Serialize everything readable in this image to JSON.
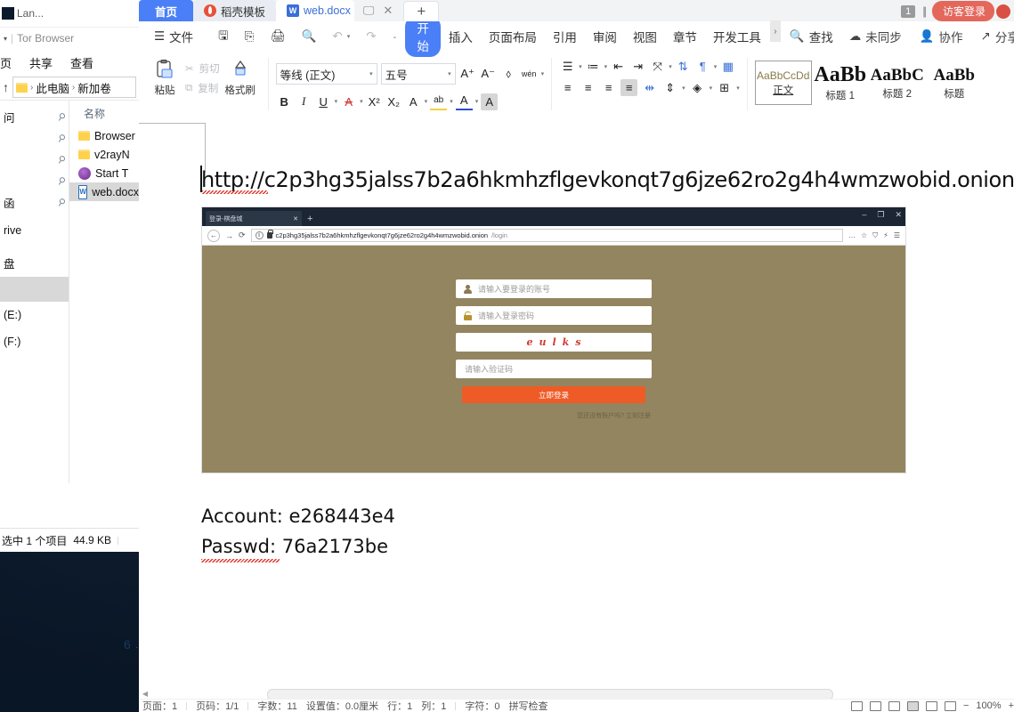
{
  "explorer": {
    "title": "Tor Browser",
    "title_prefix": "Lan...",
    "qat_caret": "▾",
    "ribbon_tabs": [
      "页",
      "共享",
      "查看"
    ],
    "up_arrow": "↑",
    "breadcrumb": [
      "此电脑",
      "新加卷"
    ],
    "crumb_sep": "›",
    "nav_items": [
      "问",
      "",
      "",
      "",
      "函",
      "rive",
      "盘",
      "",
      "(E:)",
      "(F:)"
    ],
    "pin_glyph": "📌",
    "column_header": "名称",
    "files": [
      {
        "name": "Browser",
        "icon": "folder-icon",
        "selected": false
      },
      {
        "name": "v2rayN",
        "icon": "folder-icon",
        "selected": false
      },
      {
        "name": "Start T",
        "icon": "onion-icon",
        "selected": false
      },
      {
        "name": "web.docx",
        "icon": "word-doc-icon",
        "selected": true
      }
    ],
    "status_selected": "选中 1 个项目",
    "status_size": "44.9 KB"
  },
  "wps": {
    "tabs": [
      {
        "label": "首页",
        "type": "home"
      },
      {
        "label": "稻壳模板",
        "type": "template"
      },
      {
        "label": "web.docx",
        "type": "document"
      }
    ],
    "tab_monitor_icon": "monitor-icon",
    "tab_close_icon": "✕",
    "new_tab": "+",
    "page_count": "1",
    "guest_login": "访客登录",
    "menu": {
      "file_icon": "hamburger-icon",
      "file_label": "文件",
      "quick_icons": [
        "save-icon",
        "save-as-icon",
        "print-icon",
        "print-preview-icon"
      ],
      "undo": "↶",
      "redo": "↷",
      "more_caret": "⌄",
      "tabs": [
        "开始",
        "插入",
        "页面布局",
        "引用",
        "审阅",
        "视图",
        "章节",
        "开发工具"
      ],
      "active_tab": "开始",
      "expand_arrow": "›",
      "search_label": "查找",
      "sync_label": "未同步",
      "collab_label": "协作",
      "share_label": "分享",
      "overflow": "⋮",
      "collapse": "^"
    },
    "ribbon": {
      "paste": "粘贴",
      "cut": "剪切",
      "copy": "复制",
      "format_painter": "格式刷",
      "font_name": "等线 (正文)",
      "font_size": "五号",
      "grow_font": "A⁺",
      "shrink_font": "A⁻",
      "clear_format": "clear-format-icon",
      "pinyin_guide": "wén",
      "bold": "B",
      "italic": "I",
      "underline": "U",
      "strikethrough": "A",
      "superscript": "X²",
      "subscript": "X₂",
      "char_border": "A",
      "highlight": "ab",
      "font_color": "A",
      "char_shading": "A",
      "bullets": "bullet-list-icon",
      "numbering": "numbered-list-icon",
      "decrease_indent": "decrease-indent-icon",
      "increase_indent": "increase-indent-icon",
      "paragraph_layout": "paragraph-layout-icon",
      "sort": "sort-icon",
      "show_marks": "show-marks-icon",
      "table_tool": "table-icon",
      "align_left": "align-left-icon",
      "align_center": "align-center-icon",
      "align_right": "align-right-icon",
      "align_justify": "align-justify-icon",
      "distribute": "distribute-icon",
      "line_spacing": "line-spacing-icon",
      "shading": "shading-icon",
      "borders": "borders-icon",
      "styles": [
        {
          "preview": "AaBbCcDd",
          "name": "正文",
          "selected": true,
          "size": "small"
        },
        {
          "preview": "AaBb",
          "name": "标题 1",
          "selected": false,
          "size": "big"
        },
        {
          "preview": "AaBbC",
          "name": "标题 2",
          "selected": false,
          "size": "mid"
        },
        {
          "preview": "AaBb",
          "name": "标题",
          "selected": false,
          "size": "mid"
        }
      ]
    },
    "document": {
      "url_text": "http://c2p3hg35jalss7b2a6hkmhzflgevkonqt7g6jze62ro2g4h4wmzwobid.onion",
      "account_line": "Account: e268443e4",
      "passwd_line": "Passwd: 76a2173be",
      "ruler_number": "6"
    },
    "screenshot": {
      "tab_title": "登录-棋盘城",
      "tab_close": "✕",
      "new_tab": "+",
      "win_minimize": "–",
      "win_maximize": "❐",
      "win_close": "✕",
      "back": "←",
      "forward": "→",
      "reload": "⟳",
      "info_icon": "info-icon",
      "shield_icon": "shield-icon",
      "url_host": "c2p3hg35jalss7b2a6hkmhzflgevkonqt7g6jze62ro2g4h4wmzwobid.onion",
      "url_path": "/login",
      "more_icon": "…",
      "bookmark_icon": "☆",
      "privacy_icon": "shield-icon",
      "noscript_icon": "noscript-icon",
      "menu_icon": "☰",
      "page_bg": "#92855f",
      "account_placeholder": "请输入要登录的账号",
      "password_placeholder": "请输入登录密码",
      "captcha_chars": [
        "e",
        "u",
        "l",
        "k",
        "s"
      ],
      "captcha_placeholder": "请输入验证码",
      "login_button": "立即登录",
      "register_prompt": "您还没有账户吗?",
      "register_link": "立刻注册",
      "side_badge": "mobile-icon"
    },
    "status": {
      "left_items": [
        "页面：1",
        "页码：1/1",
        "字数：11",
        "设置值：0.0厘米",
        "行：1",
        "列：1",
        "字符：0",
        "拼写检查"
      ],
      "zoom": "100%",
      "zoom_out": "−",
      "zoom_in": "+",
      "view_icons": [
        "page-view-icon",
        "outline-view-icon",
        "web-view-icon",
        "print-view-icon",
        "reading-view-icon",
        "focus-icon"
      ]
    }
  },
  "colors": {
    "accent_blue": "#4a7ff7",
    "guest_red": "#e4675c",
    "login_orange": "#ef5b26",
    "page_brown": "#92855f",
    "captcha_red": "#cf3b2e"
  }
}
